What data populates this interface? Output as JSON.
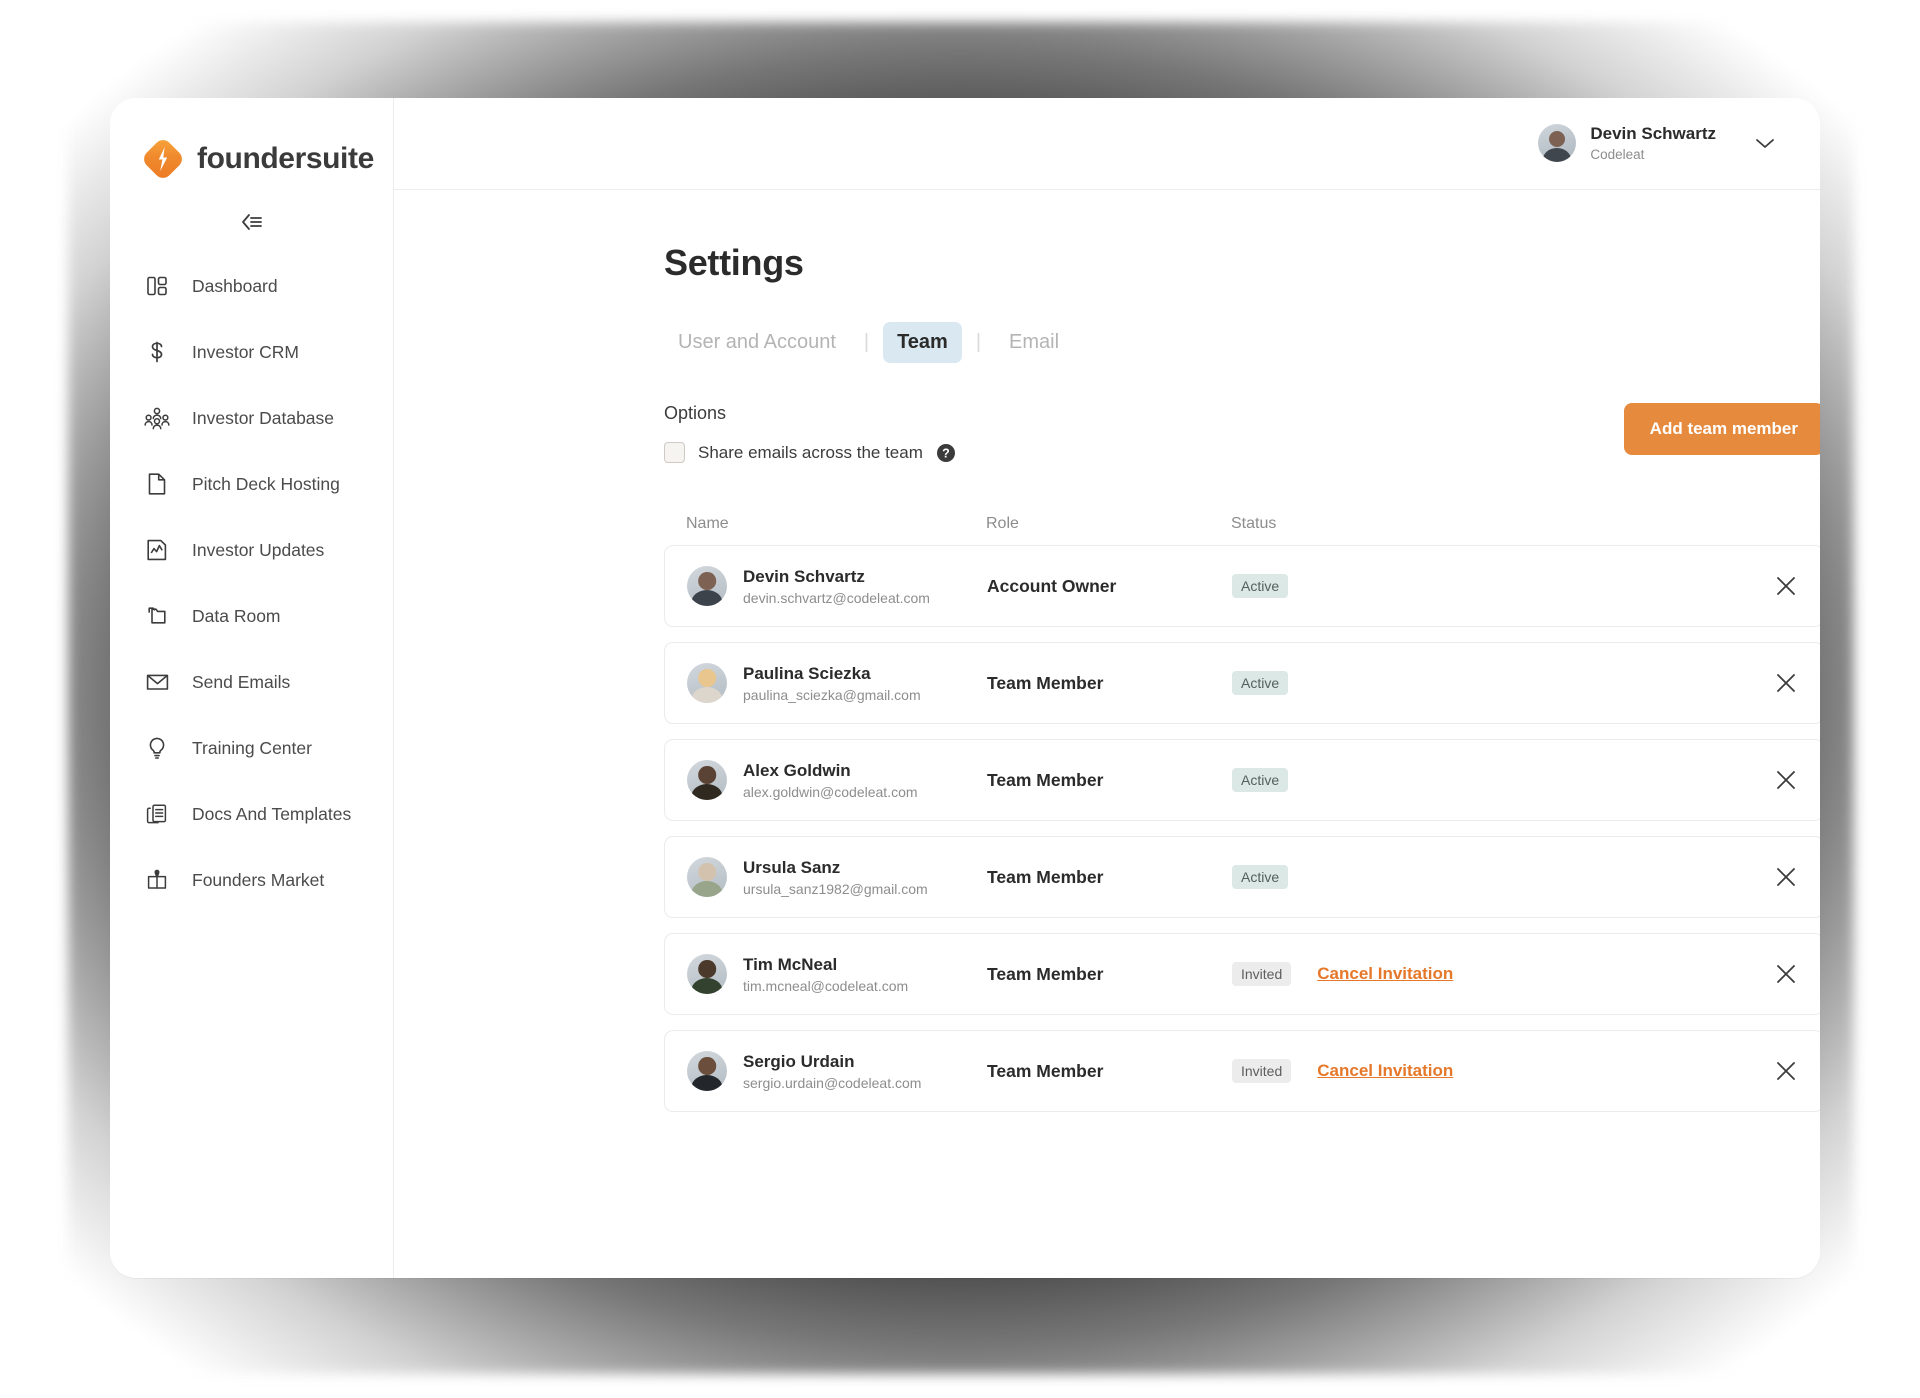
{
  "brand": {
    "name": "foundersuite",
    "logo_icon": "foundersuite-diamond-bolt-logo",
    "accent": "#e68a3e"
  },
  "sidebar": {
    "collapse_icon": "collapse-sidebar-icon",
    "items": [
      {
        "label": "Dashboard",
        "icon": "dashboard-layout-icon"
      },
      {
        "label": "Investor CRM",
        "icon": "dollar-sign-icon"
      },
      {
        "label": "Investor Database",
        "icon": "people-group-icon"
      },
      {
        "label": "Pitch Deck Hosting",
        "icon": "document-page-icon"
      },
      {
        "label": "Investor Updates",
        "icon": "chart-document-icon"
      },
      {
        "label": "Data Room",
        "icon": "folders-icon"
      },
      {
        "label": "Send Emails",
        "icon": "envelope-icon"
      },
      {
        "label": "Training Center",
        "icon": "lightbulb-icon"
      },
      {
        "label": "Docs And Templates",
        "icon": "copy-documents-icon"
      },
      {
        "label": "Founders Market",
        "icon": "gift-box-icon"
      }
    ]
  },
  "topbar": {
    "user_name": "Devin Schwartz",
    "user_org": "Codeleat",
    "avatar_icon": "user-avatar",
    "chevron_icon": "chevron-down-icon"
  },
  "page": {
    "title": "Settings",
    "tabs": [
      {
        "label": "User and Account",
        "active": false
      },
      {
        "label": "Team",
        "active": true
      },
      {
        "label": "Email",
        "active": false
      }
    ],
    "tab_separator": "|"
  },
  "options": {
    "heading": "Options",
    "share_emails_label": "Share emails across the team",
    "share_emails_checked": false,
    "help_icon": "question-mark-help-icon",
    "add_member_button": "Add team member"
  },
  "table": {
    "headers": {
      "name": "Name",
      "role": "Role",
      "status": "Status"
    },
    "remove_icon": "close-x-icon",
    "rows": [
      {
        "name": "Devin Schvartz",
        "email": "devin.schvartz@codeleat.com",
        "role": "Account Owner",
        "status": "Active",
        "status_type": "active",
        "action": ""
      },
      {
        "name": "Paulina Sciezka",
        "email": "paulina_sciezka@gmail.com",
        "role": "Team Member",
        "status": "Active",
        "status_type": "active",
        "action": ""
      },
      {
        "name": "Alex Goldwin",
        "email": "alex.goldwin@codeleat.com",
        "role": "Team Member",
        "status": "Active",
        "status_type": "active",
        "action": ""
      },
      {
        "name": "Ursula Sanz",
        "email": "ursula_sanz1982@gmail.com",
        "role": "Team Member",
        "status": "Active",
        "status_type": "active",
        "action": ""
      },
      {
        "name": "Tim McNeal",
        "email": "tim.mcneal@codeleat.com",
        "role": "Team Member",
        "status": "Invited",
        "status_type": "invited",
        "action": "Cancel Invitation"
      },
      {
        "name": "Sergio Urdain",
        "email": "sergio.urdain@codeleat.com",
        "role": "Team Member",
        "status": "Invited",
        "status_type": "invited",
        "action": "Cancel Invitation"
      }
    ]
  }
}
